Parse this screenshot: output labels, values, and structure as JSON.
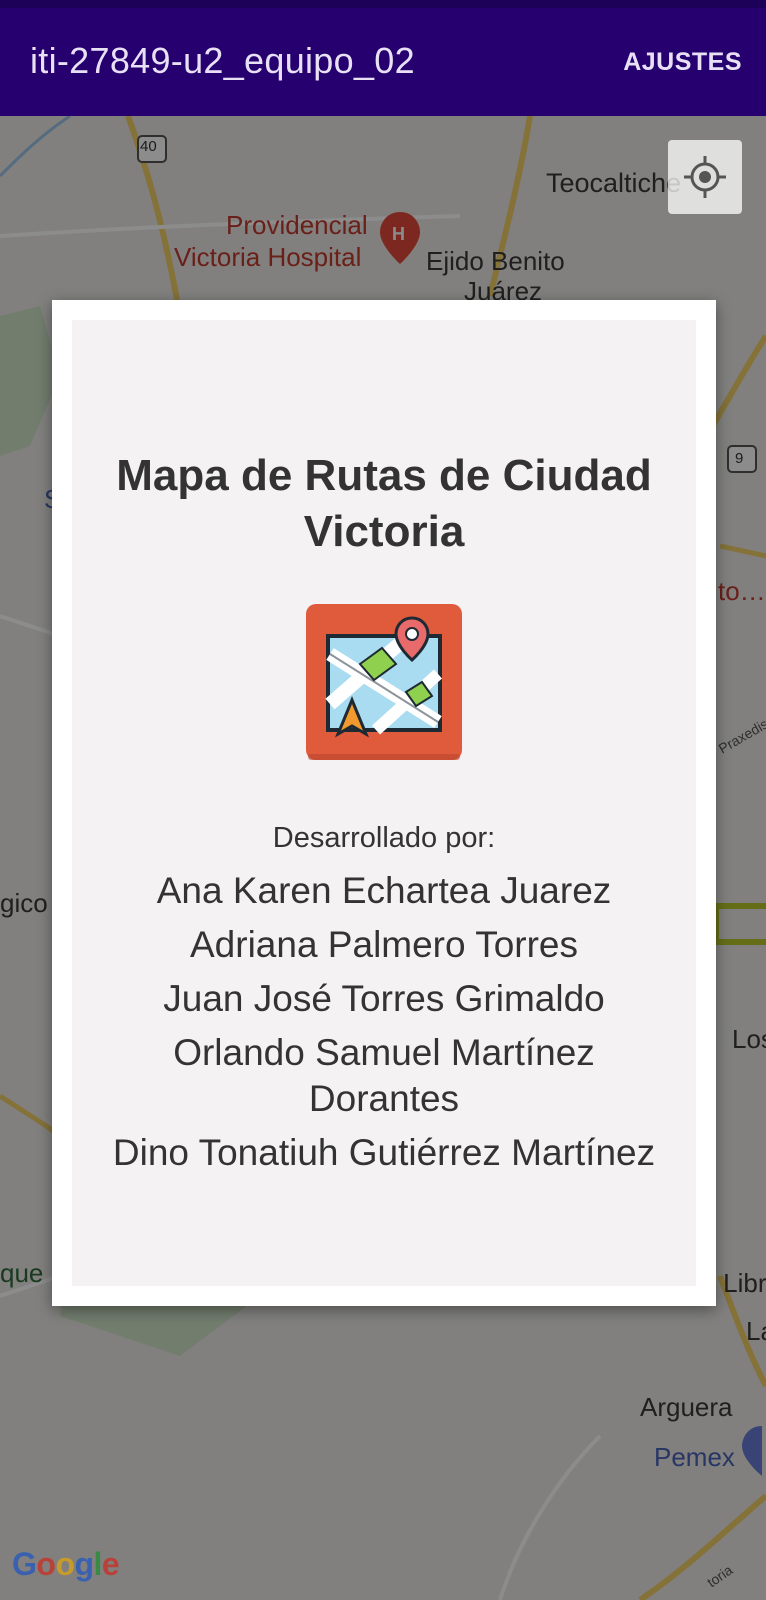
{
  "app_bar": {
    "title": "iti-27849-u2_equipo_02",
    "action": "AJUSTES"
  },
  "map": {
    "labels": {
      "route_40": "40",
      "route_9": "9",
      "teocaltiche": "Teocaltiche",
      "hospital_line1": "Providencial",
      "hospital_line2": "Victoria Hospital",
      "ejido_line1": "Ejido Benito",
      "ejido_line2": "Juárez",
      "s_partial": "S",
      "to_partial": "to…",
      "praxedis_partial": "Praxedis",
      "gico_partial": "gico T",
      "los_partial": "Los",
      "parque_partial": "que Nacional",
      "santa_partial": "Santa Libr",
      "la_partial": "La",
      "arguera": "Arguera",
      "pemex": "Pemex",
      "toria_partial": "toria"
    },
    "attribution": "Google",
    "my_location_icon": "my-location-icon"
  },
  "dialog": {
    "title": "Mapa de Rutas de Ciudad Victoria",
    "icon": "map-route-app-icon",
    "developed_by": "Desarrollado por:",
    "developers": [
      "Ana Karen Echartea Juarez",
      "Adriana Palmero Torres",
      "Juan José Torres Grimaldo",
      "Orlando Samuel Martínez Dorantes",
      "Dino Tonatiuh Gutiérrez Martínez"
    ]
  },
  "colors": {
    "app_bar": "#25006e",
    "icon_background": "#e05a3c",
    "dialog_background": "#f4f2f3"
  }
}
